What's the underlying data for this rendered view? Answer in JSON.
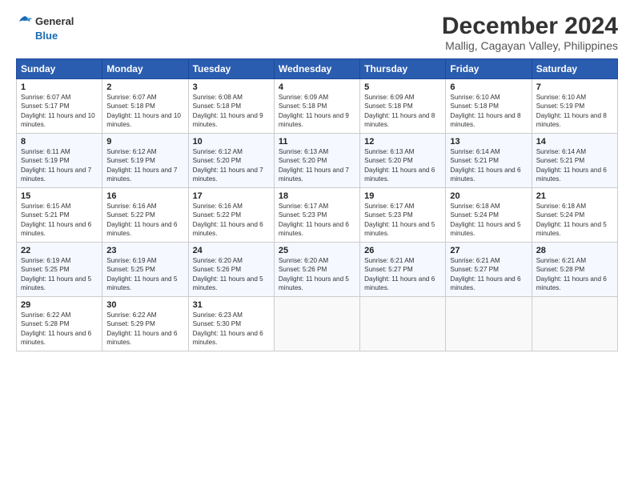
{
  "logo": {
    "line1": "General",
    "line2": "Blue"
  },
  "title": "December 2024",
  "subtitle": "Mallig, Cagayan Valley, Philippines",
  "days_of_week": [
    "Sunday",
    "Monday",
    "Tuesday",
    "Wednesday",
    "Thursday",
    "Friday",
    "Saturday"
  ],
  "weeks": [
    [
      {
        "day": "1",
        "sunrise": "6:07 AM",
        "sunset": "5:17 PM",
        "daylight": "11 hours and 10 minutes."
      },
      {
        "day": "2",
        "sunrise": "6:07 AM",
        "sunset": "5:18 PM",
        "daylight": "11 hours and 10 minutes."
      },
      {
        "day": "3",
        "sunrise": "6:08 AM",
        "sunset": "5:18 PM",
        "daylight": "11 hours and 9 minutes."
      },
      {
        "day": "4",
        "sunrise": "6:09 AM",
        "sunset": "5:18 PM",
        "daylight": "11 hours and 9 minutes."
      },
      {
        "day": "5",
        "sunrise": "6:09 AM",
        "sunset": "5:18 PM",
        "daylight": "11 hours and 8 minutes."
      },
      {
        "day": "6",
        "sunrise": "6:10 AM",
        "sunset": "5:18 PM",
        "daylight": "11 hours and 8 minutes."
      },
      {
        "day": "7",
        "sunrise": "6:10 AM",
        "sunset": "5:19 PM",
        "daylight": "11 hours and 8 minutes."
      }
    ],
    [
      {
        "day": "8",
        "sunrise": "6:11 AM",
        "sunset": "5:19 PM",
        "daylight": "11 hours and 7 minutes."
      },
      {
        "day": "9",
        "sunrise": "6:12 AM",
        "sunset": "5:19 PM",
        "daylight": "11 hours and 7 minutes."
      },
      {
        "day": "10",
        "sunrise": "6:12 AM",
        "sunset": "5:20 PM",
        "daylight": "11 hours and 7 minutes."
      },
      {
        "day": "11",
        "sunrise": "6:13 AM",
        "sunset": "5:20 PM",
        "daylight": "11 hours and 7 minutes."
      },
      {
        "day": "12",
        "sunrise": "6:13 AM",
        "sunset": "5:20 PM",
        "daylight": "11 hours and 6 minutes."
      },
      {
        "day": "13",
        "sunrise": "6:14 AM",
        "sunset": "5:21 PM",
        "daylight": "11 hours and 6 minutes."
      },
      {
        "day": "14",
        "sunrise": "6:14 AM",
        "sunset": "5:21 PM",
        "daylight": "11 hours and 6 minutes."
      }
    ],
    [
      {
        "day": "15",
        "sunrise": "6:15 AM",
        "sunset": "5:21 PM",
        "daylight": "11 hours and 6 minutes."
      },
      {
        "day": "16",
        "sunrise": "6:16 AM",
        "sunset": "5:22 PM",
        "daylight": "11 hours and 6 minutes."
      },
      {
        "day": "17",
        "sunrise": "6:16 AM",
        "sunset": "5:22 PM",
        "daylight": "11 hours and 6 minutes."
      },
      {
        "day": "18",
        "sunrise": "6:17 AM",
        "sunset": "5:23 PM",
        "daylight": "11 hours and 6 minutes."
      },
      {
        "day": "19",
        "sunrise": "6:17 AM",
        "sunset": "5:23 PM",
        "daylight": "11 hours and 5 minutes."
      },
      {
        "day": "20",
        "sunrise": "6:18 AM",
        "sunset": "5:24 PM",
        "daylight": "11 hours and 5 minutes."
      },
      {
        "day": "21",
        "sunrise": "6:18 AM",
        "sunset": "5:24 PM",
        "daylight": "11 hours and 5 minutes."
      }
    ],
    [
      {
        "day": "22",
        "sunrise": "6:19 AM",
        "sunset": "5:25 PM",
        "daylight": "11 hours and 5 minutes."
      },
      {
        "day": "23",
        "sunrise": "6:19 AM",
        "sunset": "5:25 PM",
        "daylight": "11 hours and 5 minutes."
      },
      {
        "day": "24",
        "sunrise": "6:20 AM",
        "sunset": "5:26 PM",
        "daylight": "11 hours and 5 minutes."
      },
      {
        "day": "25",
        "sunrise": "6:20 AM",
        "sunset": "5:26 PM",
        "daylight": "11 hours and 5 minutes."
      },
      {
        "day": "26",
        "sunrise": "6:21 AM",
        "sunset": "5:27 PM",
        "daylight": "11 hours and 6 minutes."
      },
      {
        "day": "27",
        "sunrise": "6:21 AM",
        "sunset": "5:27 PM",
        "daylight": "11 hours and 6 minutes."
      },
      {
        "day": "28",
        "sunrise": "6:21 AM",
        "sunset": "5:28 PM",
        "daylight": "11 hours and 6 minutes."
      }
    ],
    [
      {
        "day": "29",
        "sunrise": "6:22 AM",
        "sunset": "5:28 PM",
        "daylight": "11 hours and 6 minutes."
      },
      {
        "day": "30",
        "sunrise": "6:22 AM",
        "sunset": "5:29 PM",
        "daylight": "11 hours and 6 minutes."
      },
      {
        "day": "31",
        "sunrise": "6:23 AM",
        "sunset": "5:30 PM",
        "daylight": "11 hours and 6 minutes."
      },
      null,
      null,
      null,
      null
    ]
  ],
  "labels": {
    "sunrise": "Sunrise:",
    "sunset": "Sunset:",
    "daylight": "Daylight:"
  }
}
